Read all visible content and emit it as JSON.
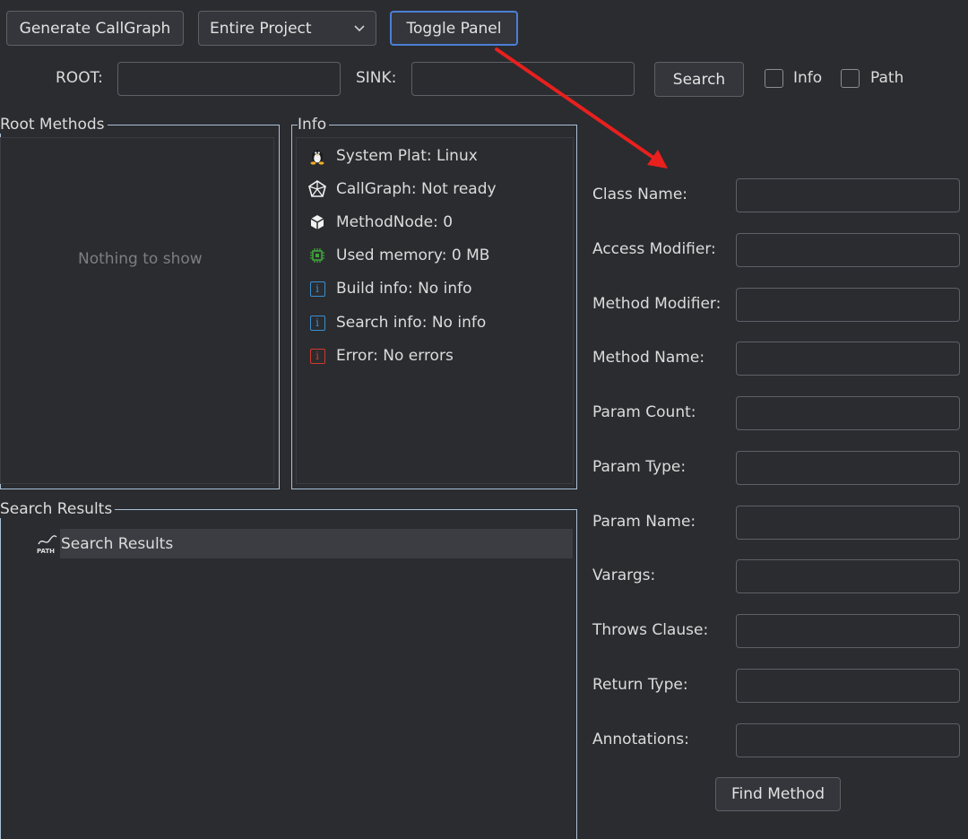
{
  "toolbar": {
    "generate_label": "Generate CallGraph",
    "scope_value": "Entire Project",
    "toggle_label": "Toggle Panel"
  },
  "search_bar": {
    "root_label": "ROOT:",
    "sink_label": "SINK:",
    "search_label": "Search",
    "info_label": "Info",
    "path_label": "Path"
  },
  "root_methods": {
    "title": "Root Methods",
    "empty_text": "Nothing to show"
  },
  "info_panel": {
    "title": "Info",
    "items": [
      {
        "icon": "linux-icon",
        "text": "System Plat: Linux"
      },
      {
        "icon": "callgraph-icon",
        "text": "CallGraph: Not ready"
      },
      {
        "icon": "cube-icon",
        "text": "MethodNode: 0"
      },
      {
        "icon": "chip-icon",
        "text": "Used memory: 0 MB"
      },
      {
        "icon": "info-icon",
        "text": "Build info: No info"
      },
      {
        "icon": "info-icon",
        "text": "Search info: No info"
      },
      {
        "icon": "error-icon",
        "text": "Error: No errors"
      }
    ]
  },
  "search_results": {
    "title": "Search Results",
    "root_item": "Search Results",
    "path_badge": "PATH"
  },
  "method_form": {
    "fields": [
      {
        "label": "Class Name:"
      },
      {
        "label": "Access Modifier:"
      },
      {
        "label": "Method Modifier:"
      },
      {
        "label": "Method Name:"
      },
      {
        "label": "Param Count:"
      },
      {
        "label": "Param Type:"
      },
      {
        "label": "Param Name:"
      },
      {
        "label": "Varargs:"
      },
      {
        "label": "Throws Clause:"
      },
      {
        "label": "Return Type:"
      },
      {
        "label": "Annotations:"
      }
    ],
    "find_label": "Find Method"
  },
  "colors": {
    "background": "#2b2c30",
    "focus": "#4a7fd6",
    "annotation_arrow": "#e8201e",
    "info_blue": "#3a8fd0",
    "error_red": "#d03a2e",
    "memory_green": "#3fa33a"
  }
}
